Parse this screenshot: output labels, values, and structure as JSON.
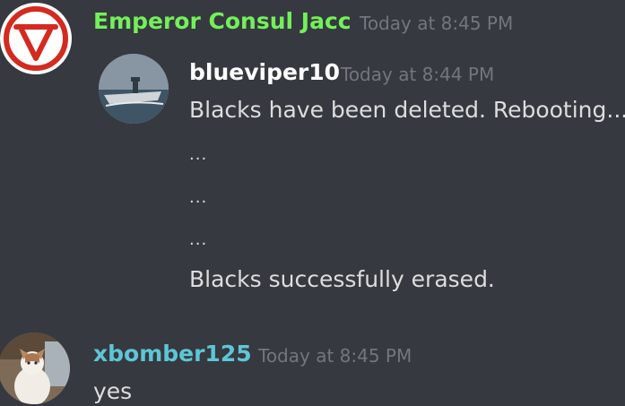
{
  "messages": [
    {
      "author": "Emperor Consul Jacc",
      "author_color": "#73f05a",
      "timestamp": "Today at 8:45 PM",
      "avatar_icon": "red-v-logo-icon",
      "quote": {
        "author": "blueviper10",
        "timestamp": "Today at 8:44 PM",
        "avatar_icon": "aircraft-carrier-photo",
        "lines": [
          "Blacks have been deleted. Rebooting...",
          "...",
          "...",
          "...",
          "Blacks successfully erased."
        ]
      }
    },
    {
      "author": "xbomber125",
      "author_color": "#5ec6d6",
      "timestamp": "Today at 8:45 PM",
      "avatar_icon": "cat-photo",
      "text": "yes"
    }
  ]
}
